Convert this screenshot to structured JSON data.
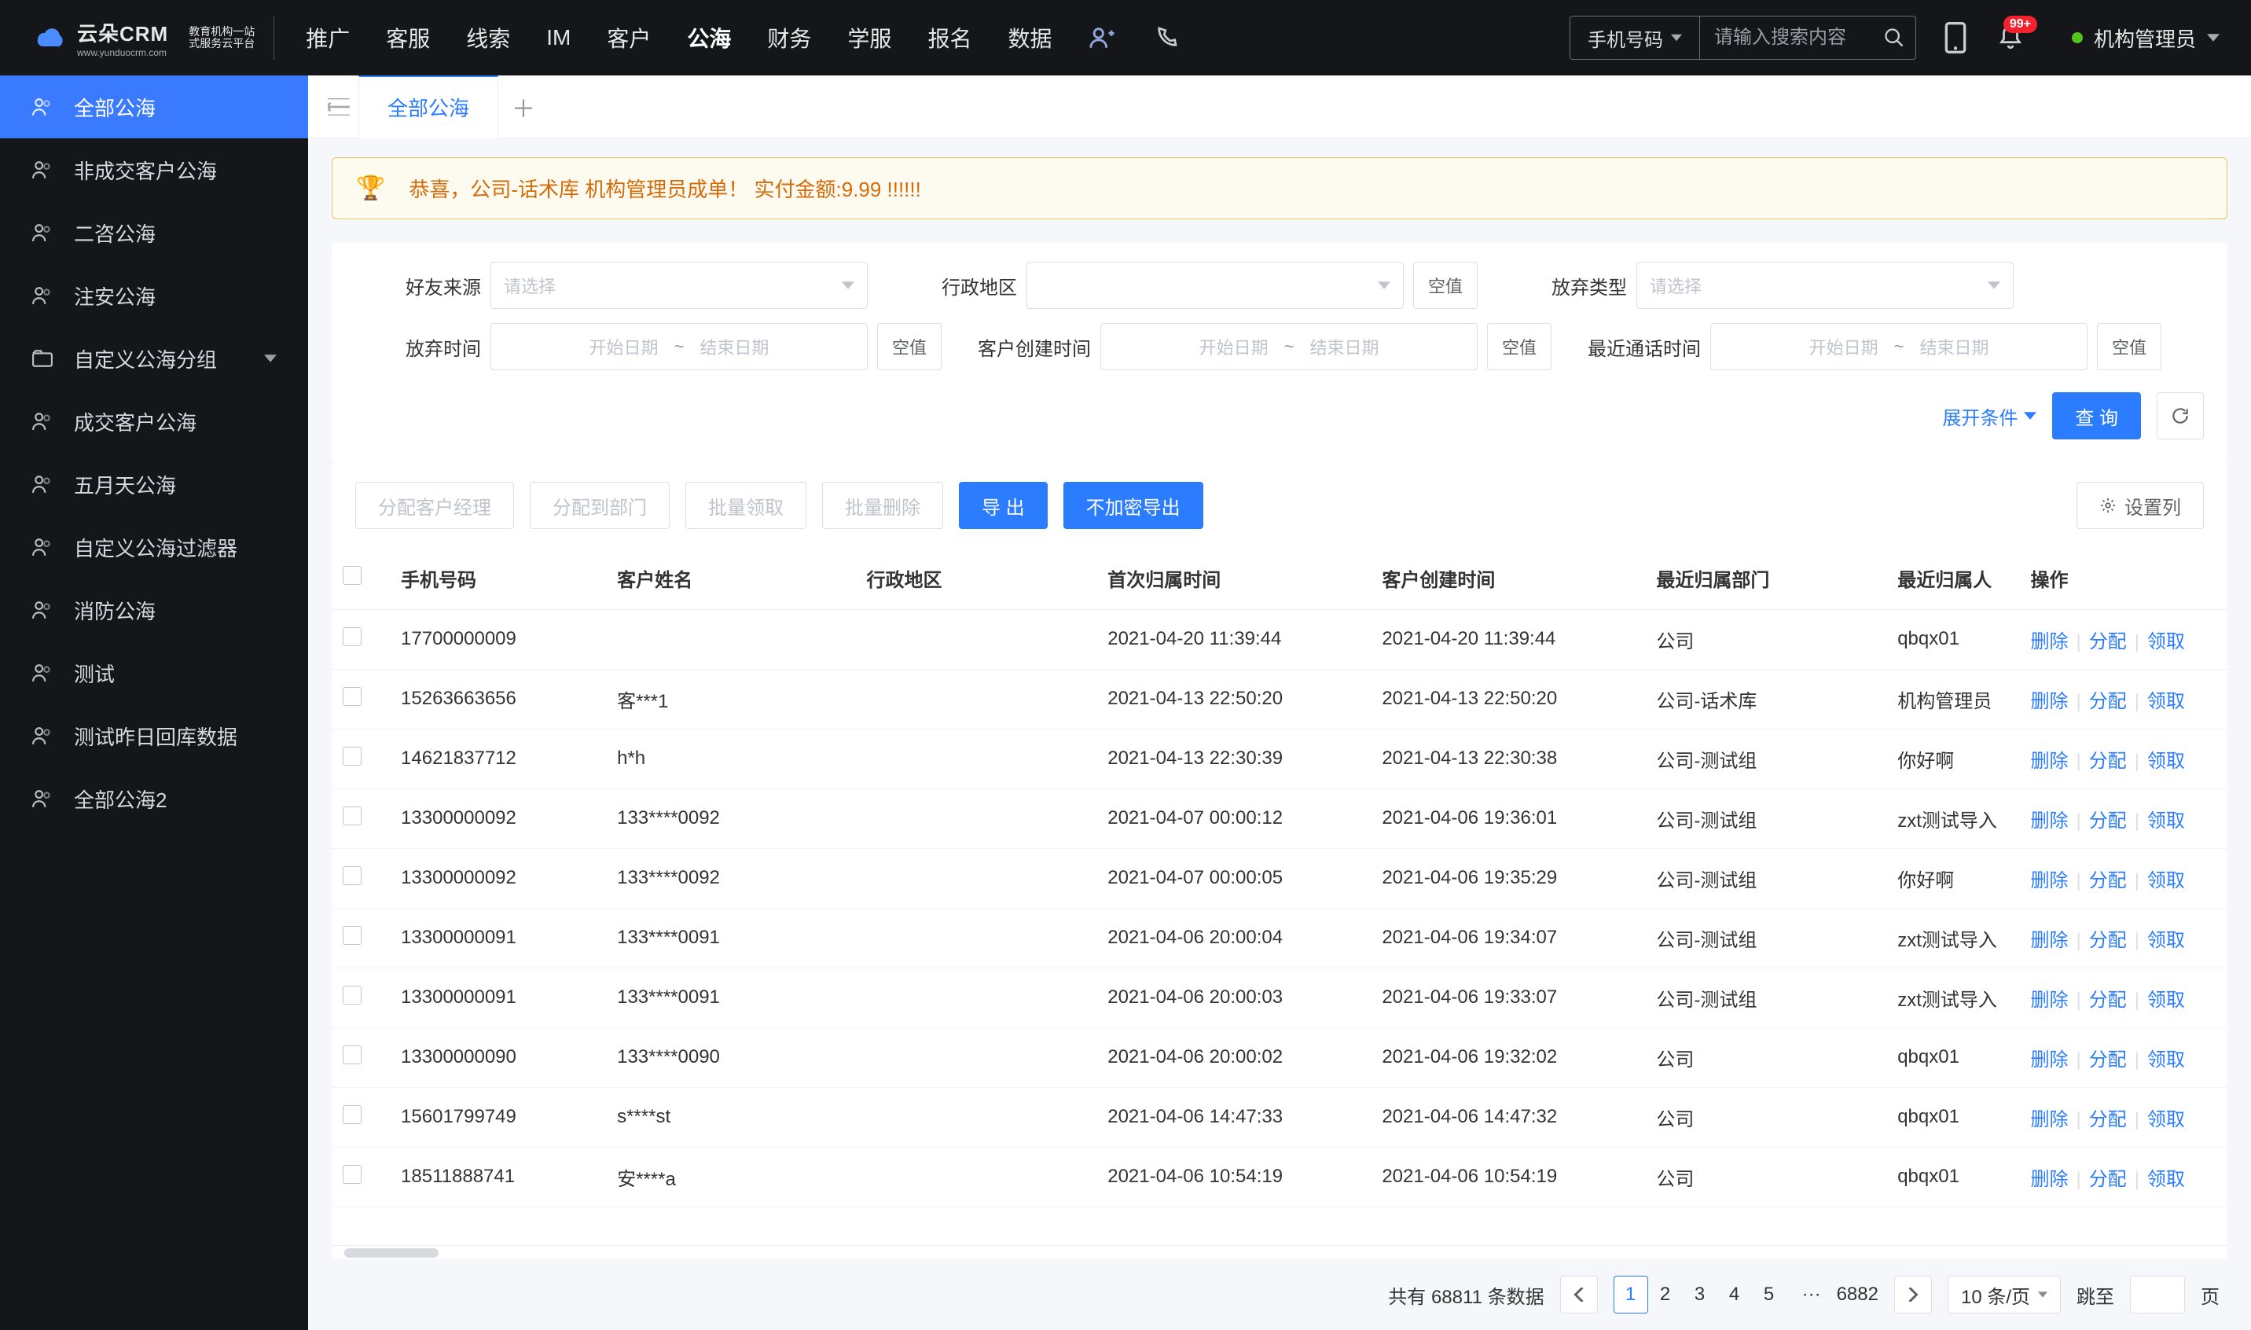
{
  "brand": {
    "name": "云朵CRM",
    "domain": "www.yunduocrm.com",
    "slogan1": "教育机构一站",
    "slogan2": "式服务云平台"
  },
  "topnav": [
    "推广",
    "客服",
    "线索",
    "IM",
    "客户",
    "公海",
    "财务",
    "学服",
    "报名",
    "数据"
  ],
  "topnav_active_index": 5,
  "search": {
    "type": "手机号码",
    "placeholder": "请输入搜索内容"
  },
  "notification_badge": "99+",
  "user": {
    "name": "机构管理员"
  },
  "sidebar": [
    {
      "label": "全部公海",
      "icon": "people",
      "active": true
    },
    {
      "label": "非成交客户公海",
      "icon": "people"
    },
    {
      "label": "二咨公海",
      "icon": "people"
    },
    {
      "label": "注安公海",
      "icon": "people"
    },
    {
      "label": "自定义公海分组",
      "icon": "folder",
      "expandable": true
    },
    {
      "label": "成交客户公海",
      "icon": "people"
    },
    {
      "label": "五月天公海",
      "icon": "people"
    },
    {
      "label": "自定义公海过滤器",
      "icon": "people"
    },
    {
      "label": "消防公海",
      "icon": "people"
    },
    {
      "label": "测试",
      "icon": "people"
    },
    {
      "label": "测试昨日回库数据",
      "icon": "people"
    },
    {
      "label": "全部公海2",
      "icon": "people"
    }
  ],
  "tabs": [
    {
      "label": "全部公海",
      "active": true
    }
  ],
  "alert": "恭喜，公司-话术库  机构管理员成单！  实付金额:9.99 !!!!!!",
  "filters": {
    "row1": [
      {
        "label": "好友来源",
        "type": "select",
        "placeholder": "请选择"
      },
      {
        "label": "行政地区",
        "type": "select",
        "placeholder": "",
        "null_btn": "空值"
      },
      {
        "label": "放弃类型",
        "type": "select",
        "placeholder": "请选择"
      }
    ],
    "row2": [
      {
        "label": "放弃时间",
        "type": "daterange",
        "start": "开始日期",
        "end": "结束日期",
        "null_btn": "空值"
      },
      {
        "label": "客户创建时间",
        "type": "daterange",
        "start": "开始日期",
        "end": "结束日期",
        "null_btn": "空值"
      },
      {
        "label": "最近通话时间",
        "type": "daterange",
        "start": "开始日期",
        "end": "结束日期",
        "null_btn": "空值"
      }
    ],
    "expand_label": "展开条件",
    "search_btn": "查 询"
  },
  "toolbar": {
    "assign_manager": "分配客户经理",
    "assign_dept": "分配到部门",
    "batch_claim": "批量领取",
    "batch_delete": "批量删除",
    "export": "导 出",
    "export_plain": "不加密导出",
    "columns": "设置列"
  },
  "table": {
    "columns": [
      "手机号码",
      "客户姓名",
      "行政地区",
      "首次归属时间",
      "客户创建时间",
      "最近归属部门",
      "最近归属人",
      "操作"
    ],
    "op_labels": {
      "delete": "删除",
      "assign": "分配",
      "claim": "领取"
    },
    "rows": [
      {
        "phone": "17700000009",
        "name": "",
        "region": "",
        "first_time": "2021-04-20 11:39:44",
        "create_time": "2021-04-20 11:39:44",
        "dept": "公司",
        "owner": "qbqx01"
      },
      {
        "phone": "15263663656",
        "name": "客***1",
        "region": "",
        "first_time": "2021-04-13 22:50:20",
        "create_time": "2021-04-13 22:50:20",
        "dept": "公司-话术库",
        "owner": "机构管理员"
      },
      {
        "phone": "14621837712",
        "name": "h*h",
        "region": "",
        "first_time": "2021-04-13 22:30:39",
        "create_time": "2021-04-13 22:30:38",
        "dept": "公司-测试组",
        "owner": "你好啊"
      },
      {
        "phone": "13300000092",
        "name": "133****0092",
        "region": "",
        "first_time": "2021-04-07 00:00:12",
        "create_time": "2021-04-06 19:36:01",
        "dept": "公司-测试组",
        "owner": "zxt测试导入"
      },
      {
        "phone": "13300000092",
        "name": "133****0092",
        "region": "",
        "first_time": "2021-04-07 00:00:05",
        "create_time": "2021-04-06 19:35:29",
        "dept": "公司-测试组",
        "owner": "你好啊"
      },
      {
        "phone": "13300000091",
        "name": "133****0091",
        "region": "",
        "first_time": "2021-04-06 20:00:04",
        "create_time": "2021-04-06 19:34:07",
        "dept": "公司-测试组",
        "owner": "zxt测试导入"
      },
      {
        "phone": "13300000091",
        "name": "133****0091",
        "region": "",
        "first_time": "2021-04-06 20:00:03",
        "create_time": "2021-04-06 19:33:07",
        "dept": "公司-测试组",
        "owner": "zxt测试导入"
      },
      {
        "phone": "13300000090",
        "name": "133****0090",
        "region": "",
        "first_time": "2021-04-06 20:00:02",
        "create_time": "2021-04-06 19:32:02",
        "dept": "公司",
        "owner": "qbqx01"
      },
      {
        "phone": "15601799749",
        "name": "s****st",
        "region": "",
        "first_time": "2021-04-06 14:47:33",
        "create_time": "2021-04-06 14:47:32",
        "dept": "公司",
        "owner": "qbqx01"
      },
      {
        "phone": "18511888741",
        "name": "安****a",
        "region": "",
        "first_time": "2021-04-06 10:54:19",
        "create_time": "2021-04-06 10:54:19",
        "dept": "公司",
        "owner": "qbqx01"
      }
    ]
  },
  "pagination": {
    "total_prefix": "共有",
    "total": "68811",
    "total_suffix": "条数据",
    "pages": [
      "1",
      "2",
      "3",
      "4",
      "5"
    ],
    "current": "1",
    "last_page": "6882",
    "page_size": "10 条/页",
    "jump_prefix": "跳至",
    "jump_suffix": "页"
  }
}
